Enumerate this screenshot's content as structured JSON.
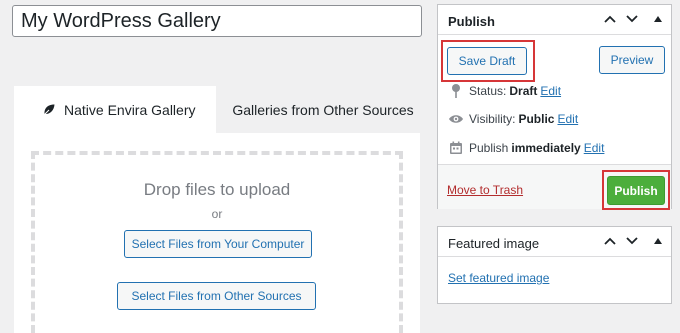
{
  "editor": {
    "title_value": "My WordPress Gallery"
  },
  "gallery": {
    "tabs": [
      {
        "label": "Native Envira Gallery",
        "icon": "leaf-icon",
        "active": true
      },
      {
        "label": "Galleries from Other Sources",
        "active": false
      }
    ],
    "drop_title": "Drop files to upload",
    "drop_or": "or",
    "select_computer_label": "Select Files from Your Computer",
    "select_other_label": "Select Files from Other Sources"
  },
  "publish": {
    "title": "Publish",
    "save_draft_label": "Save Draft",
    "preview_label": "Preview",
    "status_label": "Status:",
    "status_value": "Draft",
    "visibility_label": "Visibility:",
    "visibility_value": "Public",
    "schedule_label": "Publish",
    "schedule_value": "immediately",
    "edit_label": "Edit",
    "trash_label": "Move to Trash",
    "publish_label": "Publish"
  },
  "featured": {
    "title": "Featured image",
    "set_label": "Set featured image"
  },
  "colors": {
    "accent": "#2271b1",
    "publish_green": "#4cae3c",
    "highlight_red": "#d63638",
    "trash_red": "#b32d2e"
  }
}
